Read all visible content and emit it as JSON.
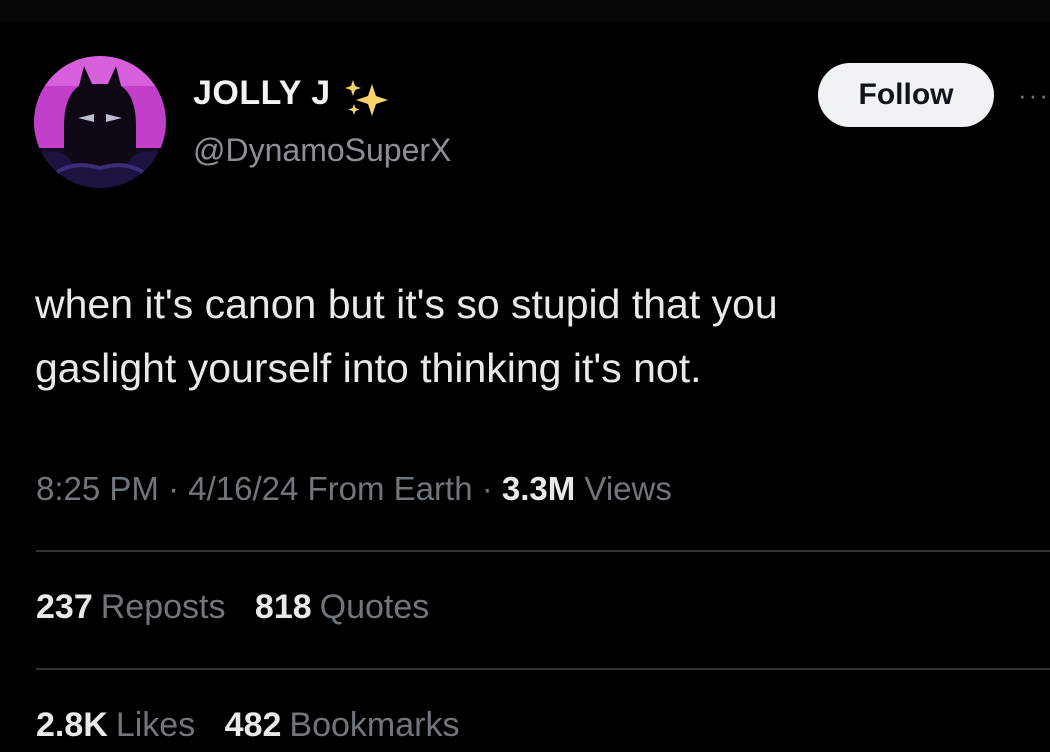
{
  "tweet": {
    "author": {
      "display_name": "JOLLY J",
      "handle": "@DynamoSuperX",
      "name_emoji": "sparkles-icon",
      "avatar_icon": "batman-avatar"
    },
    "follow_label": "Follow",
    "more_label": "···",
    "text_lines": [
      "when it's canon but it's so stupid that you",
      "gaslight yourself into thinking it's not."
    ],
    "meta": {
      "time": "8:25 PM",
      "sep1": " · ",
      "date": "4/16/24",
      "location": " From Earth",
      "sep2": " · ",
      "views_count": "3.3M",
      "views_label": " Views"
    },
    "stats": {
      "reposts_count": "237",
      "reposts_label": "Reposts",
      "quotes_count": "818",
      "quotes_label": "Quotes",
      "likes_count": "2.8K",
      "likes_label": "Likes",
      "bookmarks_count": "482",
      "bookmarks_label": "Bookmarks"
    }
  },
  "colors": {
    "background": "#000000",
    "primary_text": "#e7e9ea",
    "secondary_text": "#71767b",
    "divider": "#2f3336",
    "follow_bg": "#eff3f4",
    "follow_text": "#0f1419",
    "avatar_accent": "#c040c8"
  }
}
